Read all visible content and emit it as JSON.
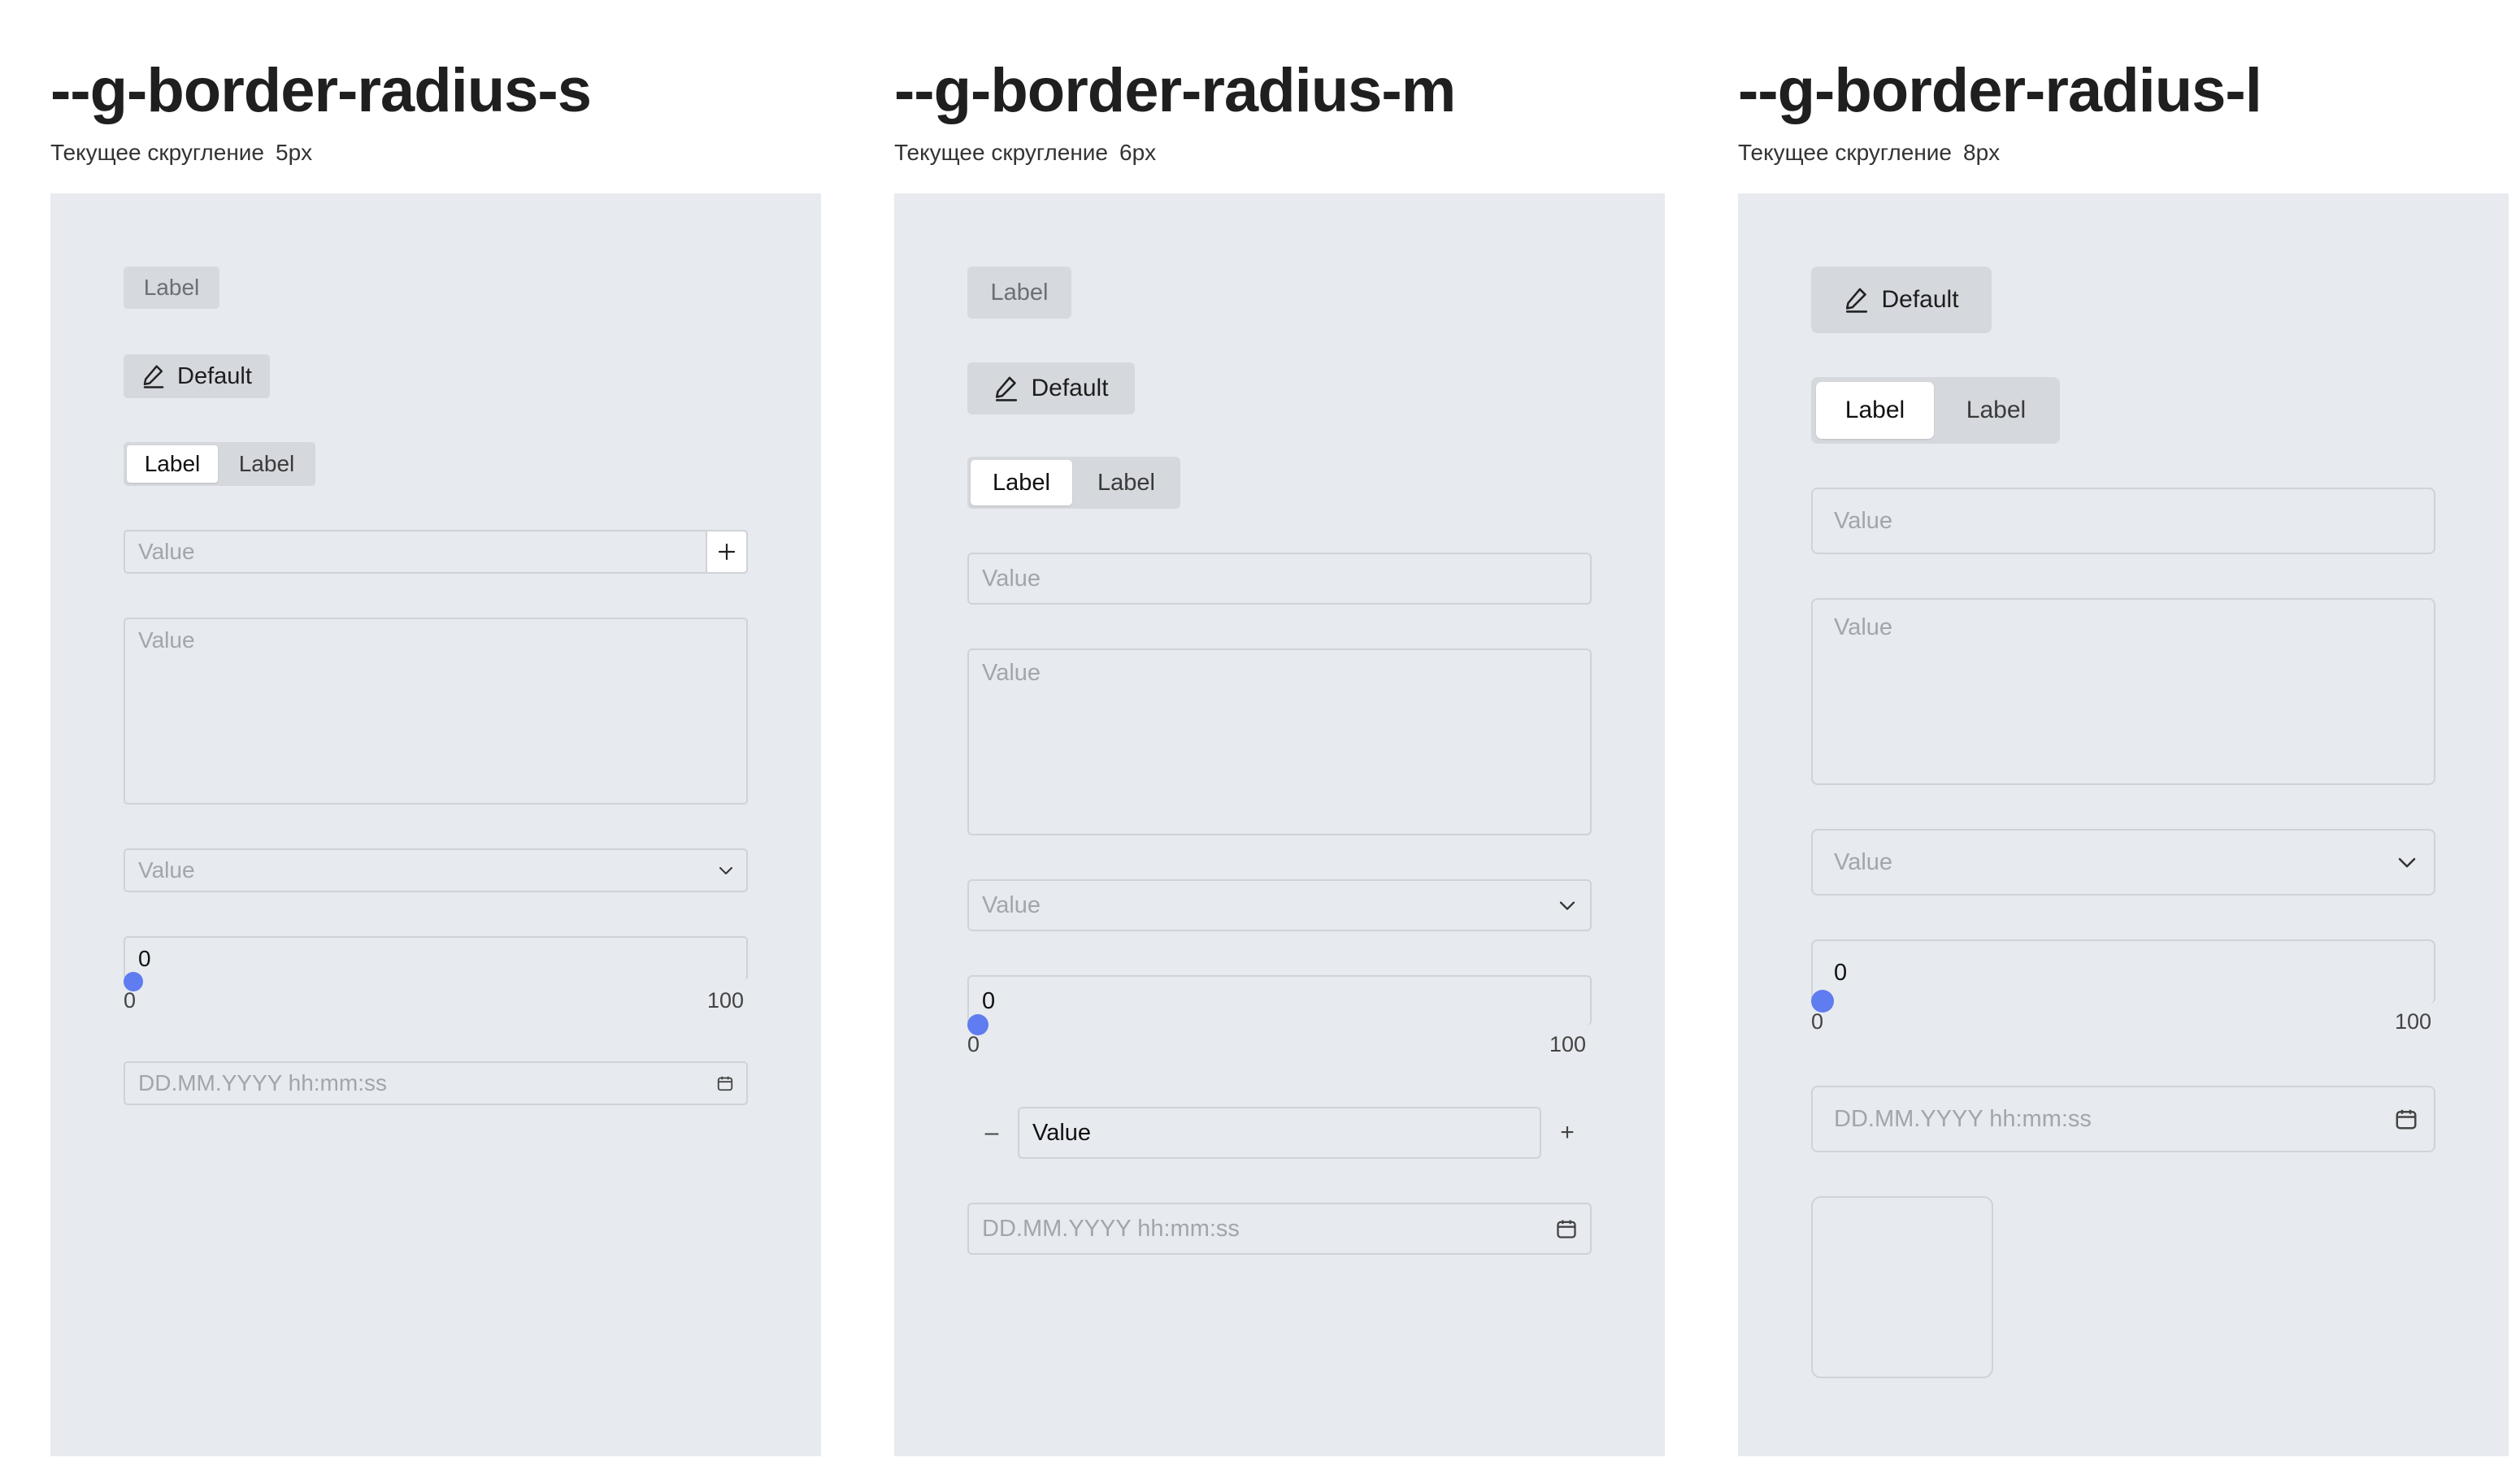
{
  "columns": [
    {
      "id": "s",
      "title": "--g-border-radius-s",
      "subtitle_label": "Текущее скругление",
      "subtitle_value": "5px",
      "label_chip": "Label",
      "button_label": "Default",
      "segmented": [
        "Label",
        "Label"
      ],
      "input_placeholder": "Value",
      "textarea_placeholder": "Value",
      "select_placeholder": "Value",
      "slider": {
        "value": "0",
        "min": "0",
        "max": "100",
        "fraction": 0
      },
      "datetime_placeholder": "DD.MM.YYYY hh:mm:ss"
    },
    {
      "id": "m",
      "title": "--g-border-radius-m",
      "subtitle_label": "Текущее скругление",
      "subtitle_value": "6px",
      "label_chip": "Label",
      "button_label": "Default",
      "segmented": [
        "Label",
        "Label"
      ],
      "input_placeholder": "Value",
      "textarea_placeholder": "Value",
      "select_placeholder": "Value",
      "slider": {
        "value": "0",
        "min": "0",
        "max": "100",
        "fraction": 0
      },
      "stepper": {
        "minus": "–",
        "value": "Value",
        "plus": "+"
      },
      "datetime_placeholder": "DD.MM.YYYY hh:mm:ss"
    },
    {
      "id": "l",
      "title": "--g-border-radius-l",
      "subtitle_label": "Текущее скругление",
      "subtitle_value": "8px",
      "button_label": "Default",
      "segmented": [
        "Label",
        "Label"
      ],
      "input_placeholder": "Value",
      "textarea_placeholder": "Value",
      "select_placeholder": "Value",
      "slider": {
        "value": "0",
        "min": "0",
        "max": "100",
        "fraction": 0
      },
      "datetime_placeholder": "DD.MM.YYYY hh:mm:ss"
    }
  ],
  "colors": {
    "panel_bg": "#e7eaee",
    "chip_bg": "#d5d8dd",
    "field_border": "#cfd3d8",
    "placeholder": "#a2a6ab",
    "slider_accent": "#5f7cf0"
  },
  "icons": [
    "pencil-icon",
    "plus-icon",
    "chevron-down-icon",
    "calendar-icon"
  ]
}
